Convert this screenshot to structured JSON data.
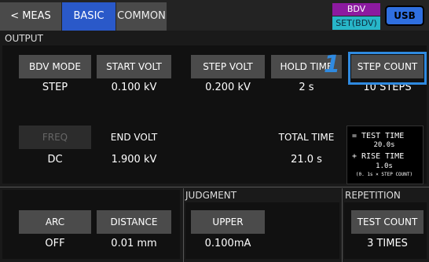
{
  "topbar": {
    "tab_meas": "< MEAS",
    "tab_basic": "BASIC",
    "tab_common": "COMMON",
    "bdv_label": "BDV",
    "set_label": "SET(BDV)",
    "usb_label": "USB"
  },
  "output": {
    "section": "OUTPUT",
    "bdv_mode": {
      "label": "BDV MODE",
      "value": "STEP"
    },
    "start_volt": {
      "label": "START VOLT",
      "value": "0.100 kV"
    },
    "step_volt": {
      "label": "STEP VOLT",
      "value": "0.200 kV"
    },
    "hold_time": {
      "label": "HOLD TIME",
      "value": "2 s"
    },
    "step_count": {
      "label": "STEP COUNT",
      "value": "10 STEPS"
    },
    "freq": {
      "label": "FREQ",
      "value": "DC"
    },
    "end_volt": {
      "label": "END VOLT",
      "value": "1.900 kV"
    },
    "total_time": {
      "label": "TOTAL TIME",
      "value": "21.0 s"
    },
    "formula": {
      "line1": "= TEST TIME",
      "line2": "20.0s",
      "line3": "+ RISE TIME",
      "line4": "1.0s",
      "line5": "(0. 1s × STEP COUNT)"
    }
  },
  "callout_number": "1",
  "lower": {
    "arc": {
      "label": "ARC",
      "value": "OFF"
    },
    "distance": {
      "label": "DISTANCE",
      "value": "0.01 mm"
    },
    "judgment_section": "JUDGMENT",
    "upper": {
      "label": "UPPER",
      "value": "0.100mA"
    },
    "repetition_section": "REPETITION",
    "test_count": {
      "label": "TEST COUNT",
      "value": "3 TIMES"
    }
  },
  "colors": {
    "accent_blue": "#2a59c9",
    "highlight_blue": "#2f8ae0",
    "bdv_purple": "#8c1aa0",
    "set_cyan": "#27b6c8"
  }
}
